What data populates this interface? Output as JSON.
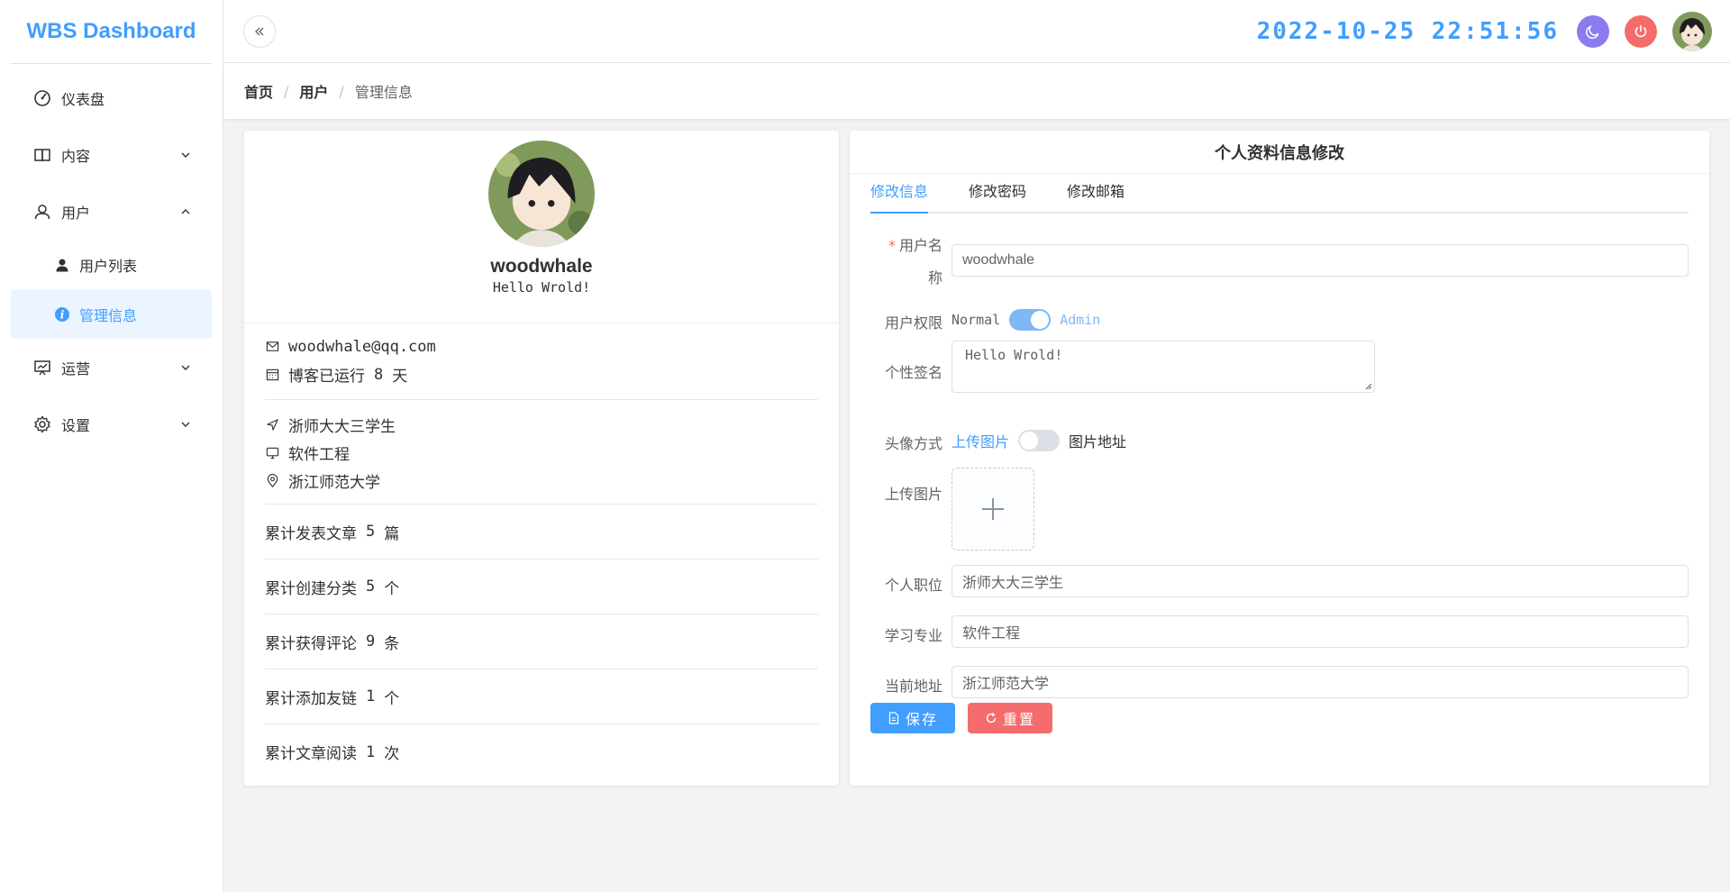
{
  "brand": "WBS Dashboard",
  "sidebar": {
    "items": [
      {
        "label": "仪表盘",
        "icon": "dashboard-icon"
      },
      {
        "label": "内容",
        "icon": "book-icon"
      },
      {
        "label": "用户",
        "icon": "user-icon"
      },
      {
        "label": "运营",
        "icon": "presentation-chart-icon"
      },
      {
        "label": "设置",
        "icon": "gear-icon"
      }
    ],
    "sub_items": [
      {
        "label": "用户列表",
        "icon": "user-filled-icon"
      },
      {
        "label": "管理信息",
        "icon": "info-icon"
      }
    ]
  },
  "header": {
    "clock": "2022-10-25 22:51:56"
  },
  "breadcrumb": [
    "首页",
    "用户",
    "管理信息"
  ],
  "profile": {
    "name": "woodwhale",
    "signature": "Hello Wrold!",
    "email": "woodwhale@qq.com",
    "running_prefix": "博客已运行",
    "running_days": "8",
    "running_unit": "天",
    "position": "浙师大大三学生",
    "major": "软件工程",
    "location": "浙江师范大学"
  },
  "stats": [
    {
      "label": "累计发表文章",
      "value": "5",
      "unit": "篇"
    },
    {
      "label": "累计创建分类",
      "value": "5",
      "unit": "个"
    },
    {
      "label": "累计获得评论",
      "value": "9",
      "unit": "条"
    },
    {
      "label": "累计添加友链",
      "value": "1",
      "unit": "个"
    },
    {
      "label": "累计文章阅读",
      "value": "1",
      "unit": "次"
    }
  ],
  "edit": {
    "title": "个人资料信息修改",
    "tabs": [
      "修改信息",
      "修改密码",
      "修改邮箱"
    ],
    "labels": {
      "username_a": "用户名",
      "username_b": "称",
      "permission": "用户权限",
      "signature": "个性签名",
      "avatar_mode": "头像方式",
      "upload": "上传图片",
      "position": "个人职位",
      "major": "学习专业",
      "address": "当前地址"
    },
    "username": "woodwhale",
    "perm_off": "Normal",
    "perm_on": "Admin",
    "signature": "Hello Wrold!",
    "avatar_opt_a": "上传图片",
    "avatar_opt_b": "图片地址",
    "position": "浙师大大三学生",
    "major": "软件工程",
    "address": "浙江师范大学",
    "save": "保存",
    "reset": "重置"
  },
  "colors": {
    "accent": "#409eff",
    "danger": "#f56c6c",
    "dark_toggle": "#8a7cf0"
  }
}
